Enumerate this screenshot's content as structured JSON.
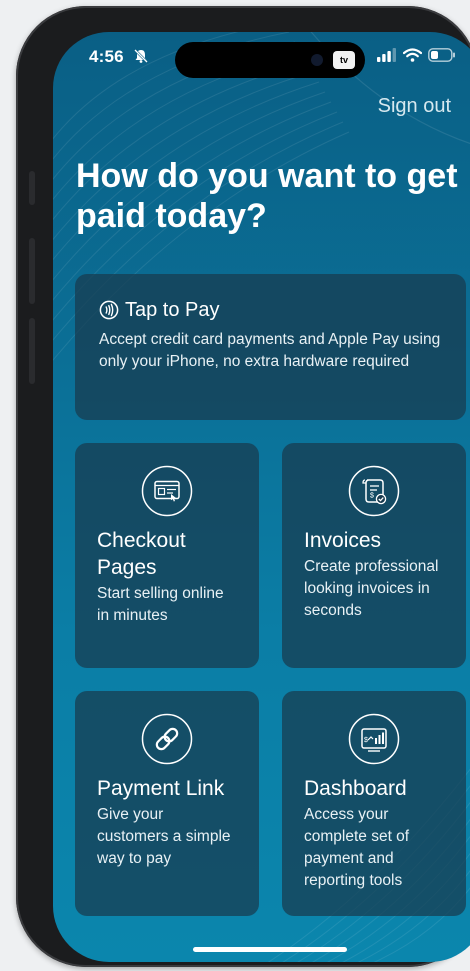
{
  "status_bar": {
    "time": "4:56",
    "tv_badge": "tv"
  },
  "header": {
    "sign_out_label": "Sign out",
    "headline": "How do you want to get paid today?"
  },
  "options": {
    "tap_to_pay": {
      "icon": "contactless-icon",
      "title": "Tap to Pay",
      "description": "Accept credit card payments and Apple Pay using only your iPhone, no extra hardware required"
    },
    "checkout_pages": {
      "icon": "browser-window-icon",
      "title": "Checkout Pages",
      "description": "Start selling online in minutes"
    },
    "invoices": {
      "icon": "receipt-scroll-icon",
      "title": "Invoices",
      "description": "Create professional looking invoices in seconds"
    },
    "payment_link": {
      "icon": "link-icon",
      "title": "Payment Link",
      "description": "Give your customers a simple way to pay"
    },
    "dashboard": {
      "icon": "dashboard-chart-icon",
      "title": "Dashboard",
      "description": "Access your complete set of payment and reporting tools"
    }
  },
  "colors": {
    "background_top": "#0a5f85",
    "background_bottom": "#0b86ad",
    "card": "#183a4e"
  }
}
